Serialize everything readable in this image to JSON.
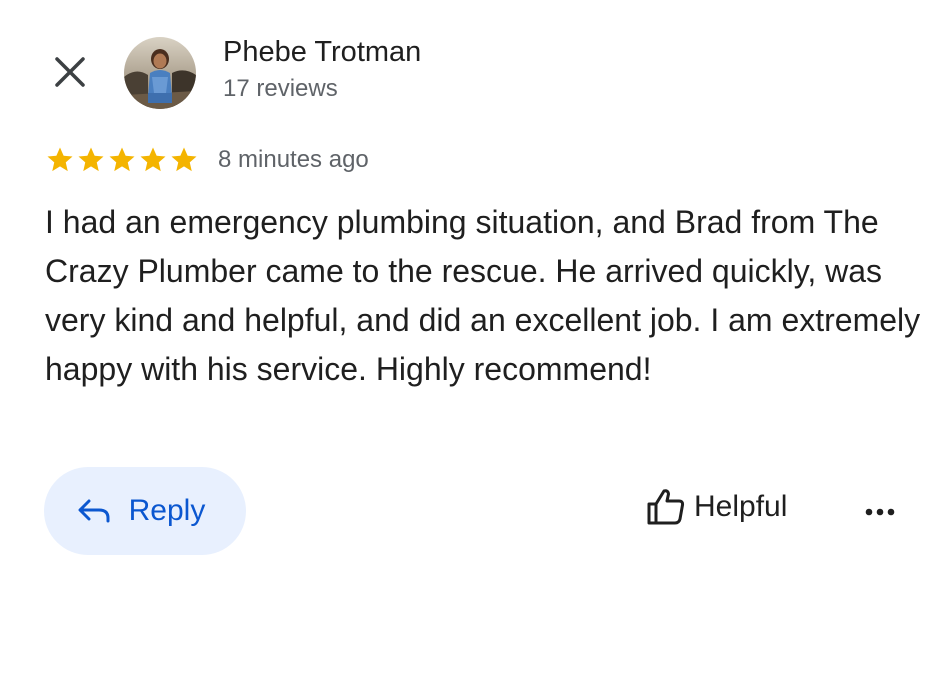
{
  "reviewer": {
    "name": "Phebe Trotman",
    "review_count": "17 reviews"
  },
  "review": {
    "rating": 5,
    "max_rating": 5,
    "time_ago": "8 minutes ago",
    "text": "I had an emergency plumbing situation, and Brad from The Crazy Plumber came to the rescue. He arrived quickly, was very kind and helpful, and did an excellent job. I am extremely happy with his service. Highly recommend!"
  },
  "actions": {
    "reply_label": "Reply",
    "helpful_label": "Helpful"
  },
  "icons": {
    "close": "close-icon",
    "reply": "reply-arrow-icon",
    "helpful": "thumbs-up-icon",
    "more": "more-horizontal-icon",
    "star": "star-icon"
  },
  "colors": {
    "star": "#f4b400",
    "reply_bg": "#e8f0fe",
    "reply_text": "#0b57d0",
    "secondary_text": "#5f6368",
    "primary_text": "#1f1f1f"
  }
}
